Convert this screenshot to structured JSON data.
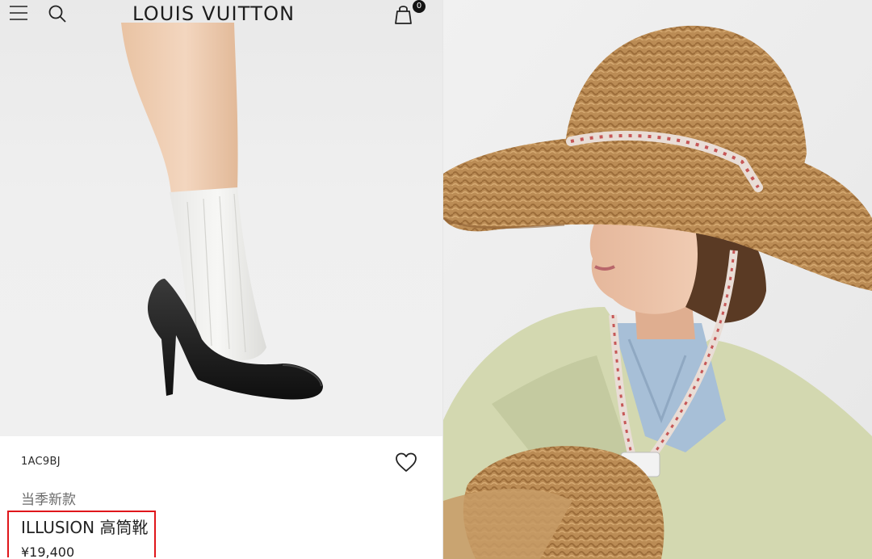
{
  "header": {
    "brand": "LOUIS VUITTON",
    "bag_count": "0",
    "icons": [
      "menu-icon",
      "search-icon",
      "shopping-bag-icon"
    ]
  },
  "product": {
    "sku": "1AC9BJ",
    "season_tag": "当季新款",
    "name": "ILLUSION 高筒靴",
    "price": "¥19,400",
    "wishlist_icon": "heart-icon"
  },
  "colors": {
    "highlight_border": "#e0161b",
    "hat_straw": "#b98a54",
    "jacket": "#d6dbb4",
    "shirt": "#a9c1d8"
  }
}
